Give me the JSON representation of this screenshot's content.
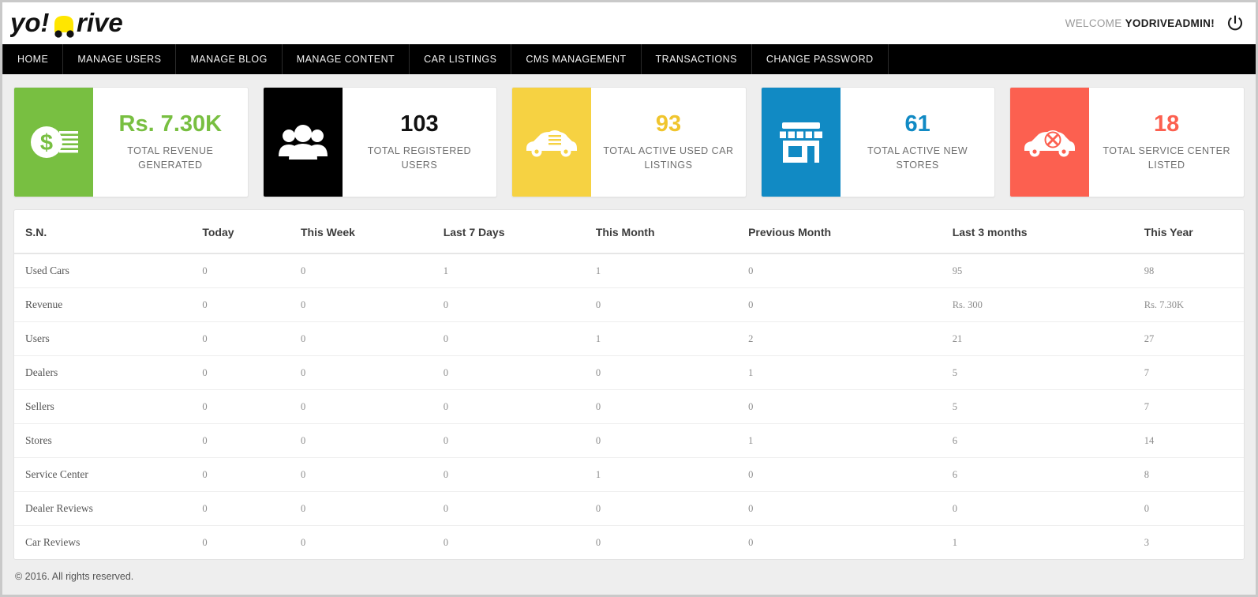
{
  "brand": {
    "logo_text_left": "yo!",
    "logo_text_right": "rive",
    "logo_accent_color": "#ffe600"
  },
  "header": {
    "welcome_prefix": "WELCOME",
    "welcome_user": "YODRIVEADMIN!",
    "logout_icon": "power-icon"
  },
  "nav": {
    "items": [
      {
        "label": "HOME"
      },
      {
        "label": "MANAGE USERS"
      },
      {
        "label": "MANAGE BLOG"
      },
      {
        "label": "MANAGE CONTENT"
      },
      {
        "label": "CAR LISTINGS"
      },
      {
        "label": "CMS MANAGEMENT"
      },
      {
        "label": "TRANSACTIONS"
      },
      {
        "label": "CHANGE PASSWORD"
      }
    ]
  },
  "cards": [
    {
      "value": "Rs. 7.30K",
      "label": "TOTAL REVENUE GENERATED",
      "color": "#78bf41",
      "value_color": "#78bf41",
      "icon": "money-icon"
    },
    {
      "value": "103",
      "label": "TOTAL REGISTERED USERS",
      "color": "#000000",
      "value_color": "#111111",
      "icon": "users-icon"
    },
    {
      "value": "93",
      "label": "TOTAL ACTIVE USED CAR LISTINGS",
      "color": "#f6d242",
      "value_color": "#f0c52e",
      "icon": "used-car-icon"
    },
    {
      "value": "61",
      "label": "TOTAL ACTIVE NEW STORES",
      "color": "#118ac4",
      "value_color": "#118ac4",
      "icon": "store-icon"
    },
    {
      "value": "18",
      "label": "TOTAL SERVICE CENTER LISTED",
      "color": "#fc6050",
      "value_color": "#fc6050",
      "icon": "service-car-icon"
    }
  ],
  "table": {
    "columns": [
      "S.N.",
      "Today",
      "This Week",
      "Last 7 Days",
      "This Month",
      "Previous Month",
      "Last 3 months",
      "This Year"
    ],
    "rows": [
      {
        "cells": [
          "Used Cars",
          "0",
          "0",
          "1",
          "1",
          "0",
          "95",
          "98"
        ]
      },
      {
        "cells": [
          "Revenue",
          "0",
          "0",
          "0",
          "0",
          "0",
          "Rs. 300",
          "Rs. 7.30K"
        ]
      },
      {
        "cells": [
          "Users",
          "0",
          "0",
          "0",
          "1",
          "2",
          "21",
          "27"
        ]
      },
      {
        "cells": [
          "Dealers",
          "0",
          "0",
          "0",
          "0",
          "1",
          "5",
          "7"
        ]
      },
      {
        "cells": [
          "Sellers",
          "0",
          "0",
          "0",
          "0",
          "0",
          "5",
          "7"
        ]
      },
      {
        "cells": [
          "Stores",
          "0",
          "0",
          "0",
          "0",
          "1",
          "6",
          "14"
        ]
      },
      {
        "cells": [
          "Service Center",
          "0",
          "0",
          "0",
          "1",
          "0",
          "6",
          "8"
        ]
      },
      {
        "cells": [
          "Dealer Reviews",
          "0",
          "0",
          "0",
          "0",
          "0",
          "0",
          "0"
        ]
      },
      {
        "cells": [
          "Car Reviews",
          "0",
          "0",
          "0",
          "0",
          "0",
          "1",
          "3"
        ]
      }
    ]
  },
  "footer": {
    "copyright": "© 2016. All rights reserved."
  }
}
